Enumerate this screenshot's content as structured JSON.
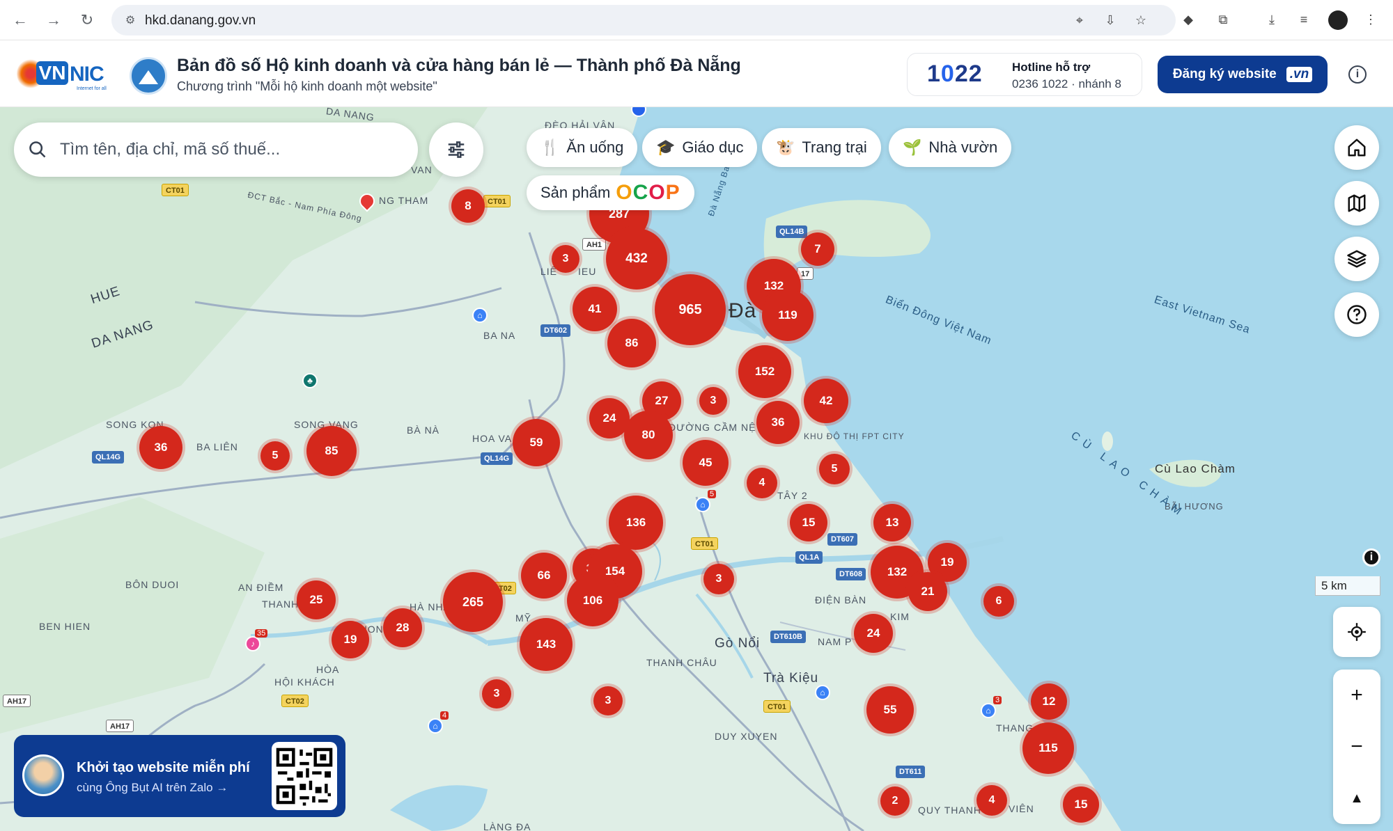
{
  "browser": {
    "url": "hkd.danang.gov.vn"
  },
  "header": {
    "logo_text_vn": "VN",
    "logo_text_nic": "NIC",
    "logo_tagline": "Internet for all",
    "title": "Bản đồ số Hộ kinh doanh và cửa hàng bán lẻ — Thành phố Đà Nẵng",
    "subtitle": "Chương trình \"Mỗi hộ kinh doanh một website\"",
    "hotline_number_prefix": "1",
    "hotline_number_o": "0",
    "hotline_number_suffix": "22",
    "hotline_label": "Hotline hỗ trợ",
    "hotline_phone": "0236 1022 · nhánh 8",
    "register_label": "Đăng ký website",
    "register_badge": ".vn"
  },
  "search": {
    "placeholder": "Tìm tên, địa chỉ, mã số thuế..."
  },
  "categories": [
    {
      "label": "Ăn uống",
      "icon": "utensils-icon"
    },
    {
      "label": "Giáo dục",
      "icon": "graduation-cap-icon"
    },
    {
      "label": "Trang trại",
      "icon": "farm-icon"
    },
    {
      "label": "Nhà vườn",
      "icon": "sprout-icon"
    }
  ],
  "ocop": {
    "label": "Sản phẩm",
    "logo": [
      "O",
      "C",
      "O",
      "P"
    ]
  },
  "map": {
    "scale": "5 km",
    "place_labels": [
      "ĐÈO HẢI VÂN",
      "DA NANG",
      "NG THAM",
      "ĐCT Bắc - Nam Phía Đông",
      "HUE",
      "DA NANG",
      "BA NA",
      "SONG KON",
      "SONG VANG",
      "BÀ NÀ",
      "BA LIÊN",
      "HOA VA",
      "ĐƯỜNG CẦM NỆ",
      "KHU ĐÔ THỊ FPT CITY",
      "TÂY 2",
      "BÔN DUOI",
      "AN ĐIỀM",
      "THANH",
      "BEN HIEN",
      "HÀ NHA",
      "MỸ",
      "THUONG",
      "HÒA",
      "HỘI KHÁCH",
      "THANH CHÂU",
      "Gò Nổi",
      "Trà Kiệu",
      "DUY XUYEN",
      "ĐIỆN BÀN",
      "NAM P",
      "KIM",
      "THANG AN",
      "QUY THANH",
      "VIÊN",
      "LÀNG ĐẠ",
      "Đà N",
      "LIÊ",
      "IEU",
      "VAN"
    ],
    "sea_labels": [
      "Biển Đông Việt Nam",
      "East Vietnam Sea",
      "Cù Lao Chàm",
      "BÃI HƯƠNG",
      "CÙ LAO CHÀM",
      "Đà Nẵng Bay"
    ],
    "road_tags": [
      "CT01",
      "CT01",
      "AH1",
      "QL14B",
      "DT602",
      "QL14G",
      "QL14G",
      "CT01",
      "DT607",
      "QL1A",
      "DT608",
      "DT610B",
      "CT02",
      "CT02",
      "AH17",
      "AH17",
      "CT01",
      "DT611",
      "17"
    ],
    "clusters": [
      {
        "count": "8"
      },
      {
        "count": "287"
      },
      {
        "count": "3"
      },
      {
        "count": "432"
      },
      {
        "count": "7"
      },
      {
        "count": "132"
      },
      {
        "count": "41"
      },
      {
        "count": "965"
      },
      {
        "count": "119"
      },
      {
        "count": "86"
      },
      {
        "count": "152"
      },
      {
        "count": "27"
      },
      {
        "count": "3"
      },
      {
        "count": "42"
      },
      {
        "count": "24"
      },
      {
        "count": "36"
      },
      {
        "count": "80"
      },
      {
        "count": "59"
      },
      {
        "count": "36"
      },
      {
        "count": "5"
      },
      {
        "count": "85"
      },
      {
        "count": "45"
      },
      {
        "count": "5"
      },
      {
        "count": "4"
      },
      {
        "count": "136"
      },
      {
        "count": "15"
      },
      {
        "count": "13"
      },
      {
        "count": "33"
      },
      {
        "count": "154"
      },
      {
        "count": "132"
      },
      {
        "count": "19"
      },
      {
        "count": "66"
      },
      {
        "count": "3"
      },
      {
        "count": "21"
      },
      {
        "count": "106"
      },
      {
        "count": "265"
      },
      {
        "count": "25"
      },
      {
        "count": "6"
      },
      {
        "count": "24"
      },
      {
        "count": "28"
      },
      {
        "count": "19"
      },
      {
        "count": "143"
      },
      {
        "count": "3"
      },
      {
        "count": "3"
      },
      {
        "count": "55"
      },
      {
        "count": "12"
      },
      {
        "count": "115"
      },
      {
        "count": "2"
      },
      {
        "count": "4"
      },
      {
        "count": "15"
      }
    ],
    "poi_badges": [
      "5",
      "4",
      "3",
      "35"
    ]
  },
  "promo": {
    "title": "Khởi tạo website miễn phí",
    "subtitle": "cùng Ông Bụt AI trên Zalo →"
  },
  "colors": {
    "cluster": "#d4281c",
    "brand_navy": "#0d3b91",
    "sea": "#9fd3ea",
    "land": "#dfeee6"
  }
}
